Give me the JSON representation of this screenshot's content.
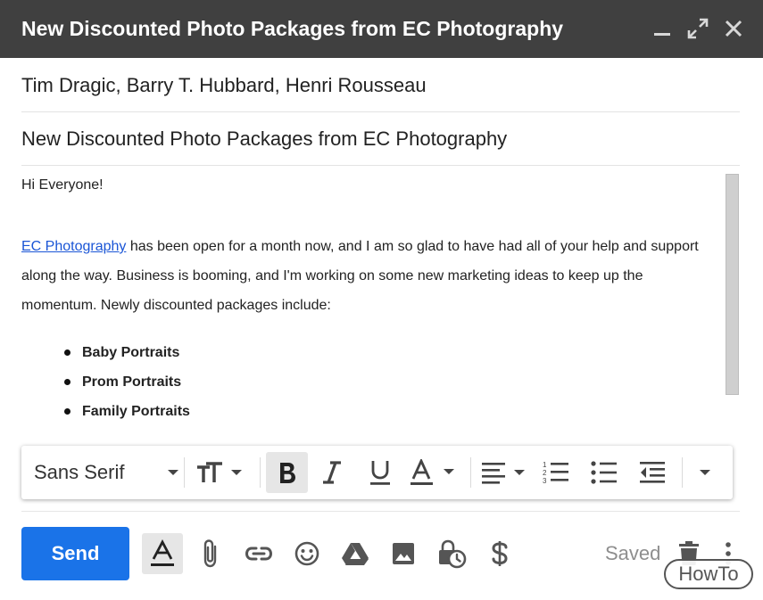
{
  "window": {
    "title": "New Discounted Photo Packages from EC Photography",
    "icons": [
      "minimize-icon",
      "expand-icon",
      "close-icon"
    ]
  },
  "compose": {
    "recipients": "Tim Dragic, Barry T. Hubbard, Henri Rousseau",
    "subject": "New Discounted Photo Packages from EC Photography"
  },
  "body": {
    "greeting": "Hi Everyone!",
    "link_text": "EC Photography",
    "paragraph_rest": " has been open for a month now, and I am so glad to have had all of your help and support along the way. Business is booming, and I'm working on some new marketing ideas to keep up the momentum. Newly discounted packages include:",
    "list_items": [
      "Baby Portraits",
      "Prom Portraits",
      "Family Portraits"
    ]
  },
  "formatting_toolbar": {
    "font": "Sans Serif",
    "buttons": [
      "text-size-icon",
      "bold-icon",
      "italic-icon",
      "underline-icon",
      "text-color-icon",
      "align-icon",
      "numbered-list-icon",
      "bulleted-list-icon",
      "indent-less-icon",
      "more-options-icon"
    ],
    "active": "bold-icon"
  },
  "footer": {
    "send_label": "Send",
    "saved_text": "Saved",
    "tools": [
      "formatting-options-icon",
      "attach-icon",
      "link-icon",
      "emoji-icon",
      "drive-icon",
      "photo-icon",
      "confidential-mode-icon",
      "money-icon",
      "trash-icon",
      "more-vert-icon"
    ]
  },
  "watermark": {
    "text": "HowTo"
  },
  "colors": {
    "titlebar": "#404040",
    "send": "#1a73e8",
    "link": "#1a55d6"
  }
}
